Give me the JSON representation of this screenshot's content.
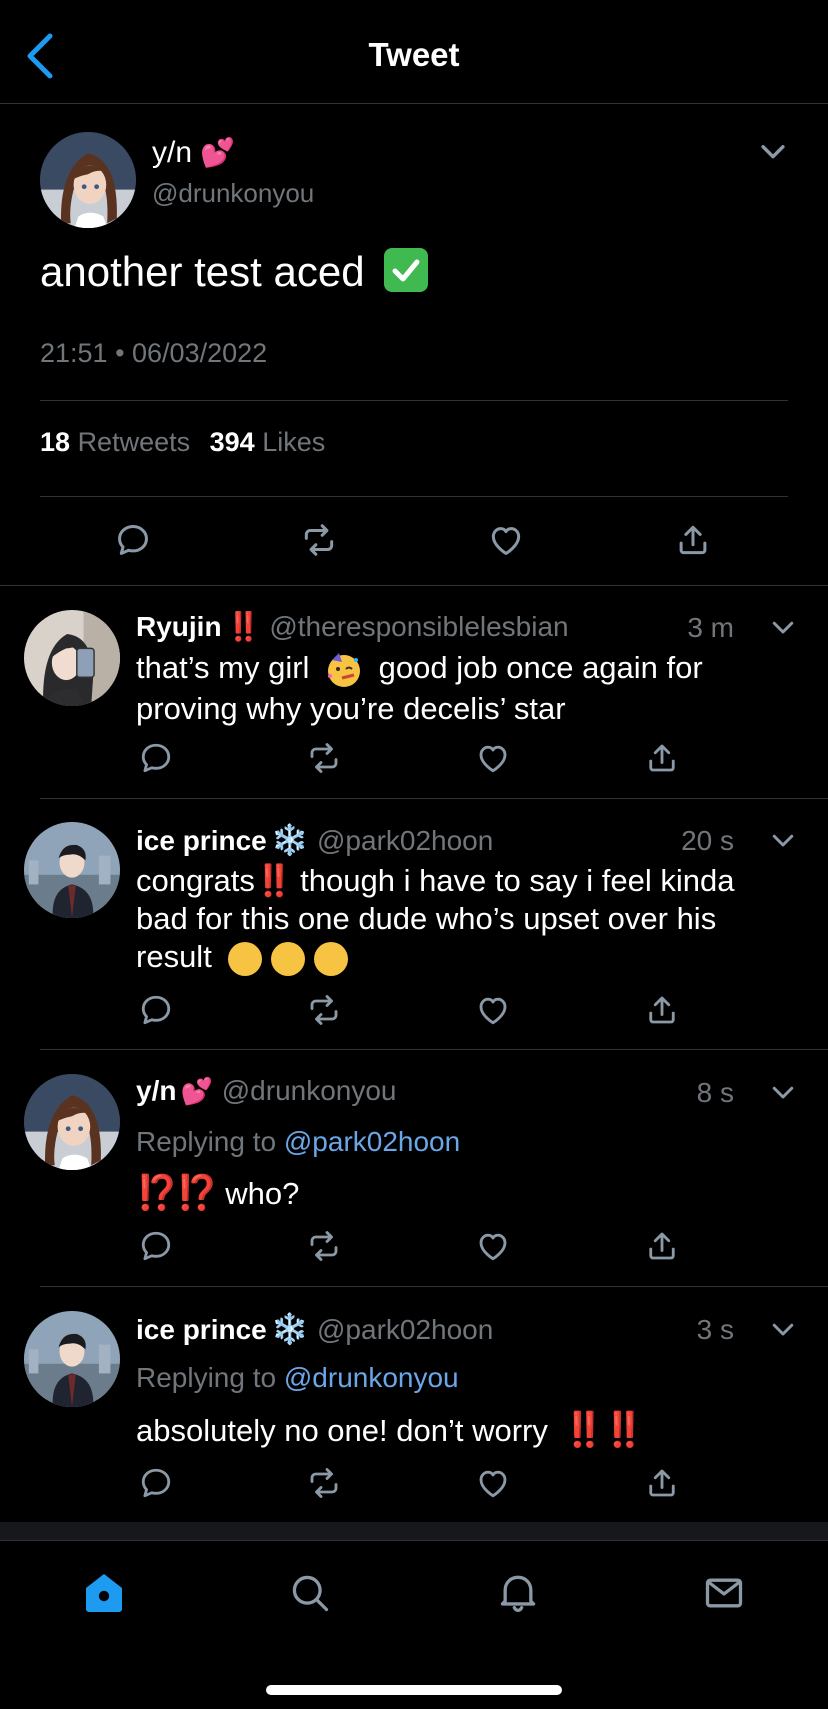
{
  "header": {
    "title": "Tweet"
  },
  "main_tweet": {
    "name": "y/n",
    "name_emoji": "💕",
    "handle": "@drunkonyou",
    "text": "another test aced",
    "text_emoji": "✅",
    "timestamp": "21:51 • 06/03/2022",
    "retweets_count": "18",
    "retweets_label": "Retweets",
    "likes_count": "394",
    "likes_label": "Likes"
  },
  "replies": [
    {
      "name": "Ryujin",
      "name_badge": "‼️",
      "handle": "@theresponsiblelesbian",
      "time": "3 m",
      "line1_a": "that’s my girl",
      "line1_emoji": "🥳",
      "line1_b": "good job once again for",
      "line2": "proving why you’re decelis’ star"
    },
    {
      "name": "ice prince",
      "name_badge": "❄️",
      "handle": "@park02hoon",
      "time": "20 s",
      "line1_a": "congrats",
      "line1_emoji": "‼️",
      "line1_b": "though i have to say i feel kinda",
      "line2": "bad for this one dude who’s upset over his",
      "line3": "result",
      "line3_emoji": "🤣🤣🤣"
    },
    {
      "name": "y/n",
      "name_badge": "💕",
      "handle": "@drunkonyou",
      "time": "8 s",
      "reply_to_label": "Replying to",
      "reply_to_handle": "@park02hoon",
      "text_emoji": "⁉️⁉️",
      "text": "who?"
    },
    {
      "name": "ice prince",
      "name_badge": "❄️",
      "handle": "@park02hoon",
      "time": "3 s",
      "reply_to_label": "Replying to",
      "reply_to_handle": "@drunkonyou",
      "text": "absolutely no one! don’t worry",
      "text_emoji": "‼️‼️"
    }
  ],
  "tab_bar": {
    "items": [
      "home-icon",
      "search-icon",
      "bell-icon",
      "mail-icon"
    ],
    "active": "home-icon"
  },
  "colors": {
    "background": "#000000",
    "accent": "#1d9bf0",
    "link": "#6ba6e8",
    "secondary_text": "#71767b",
    "divider": "#2f3336"
  }
}
